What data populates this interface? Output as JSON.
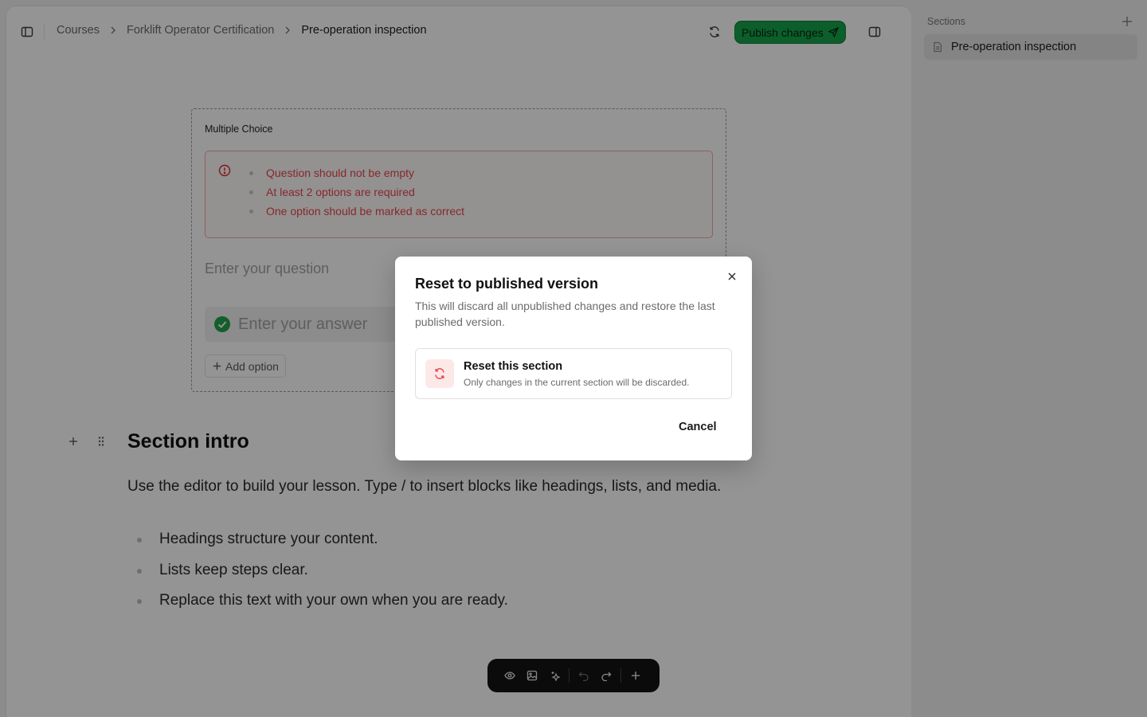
{
  "breadcrumb": {
    "items": [
      "Courses",
      "Forklift Operator Certification"
    ],
    "current": "Pre-operation inspection"
  },
  "toolbar": {
    "publish_label": "Publish changes"
  },
  "question": {
    "type_label": "Multiple Choice",
    "errors": [
      "Question should not be empty",
      "At least 2 options are required",
      "One option should be marked as correct"
    ],
    "question_placeholder": "Enter your question",
    "answer_placeholder": "Enter your answer",
    "add_option_label": "Add option"
  },
  "section": {
    "title": "Section intro",
    "paragraph": "Use the editor to build your lesson. Type / to insert blocks like headings, lists, and media.",
    "bullets": [
      "Headings structure your content.",
      "Lists keep steps clear.",
      "Replace this text with your own when you are ready."
    ]
  },
  "sidebar": {
    "title": "Sections",
    "items": [
      {
        "label": "Pre-operation inspection"
      }
    ]
  },
  "modal": {
    "title": "Reset to published version",
    "description": "This will discard all unpublished changes and restore the last published version.",
    "option": {
      "title": "Reset this section",
      "description": "Only changes in the current section will be discarded."
    },
    "cancel_label": "Cancel"
  },
  "colors": {
    "accent": "#16a34a",
    "error": "#e5484d",
    "overlay": "rgba(0,0,0,0.42)"
  }
}
